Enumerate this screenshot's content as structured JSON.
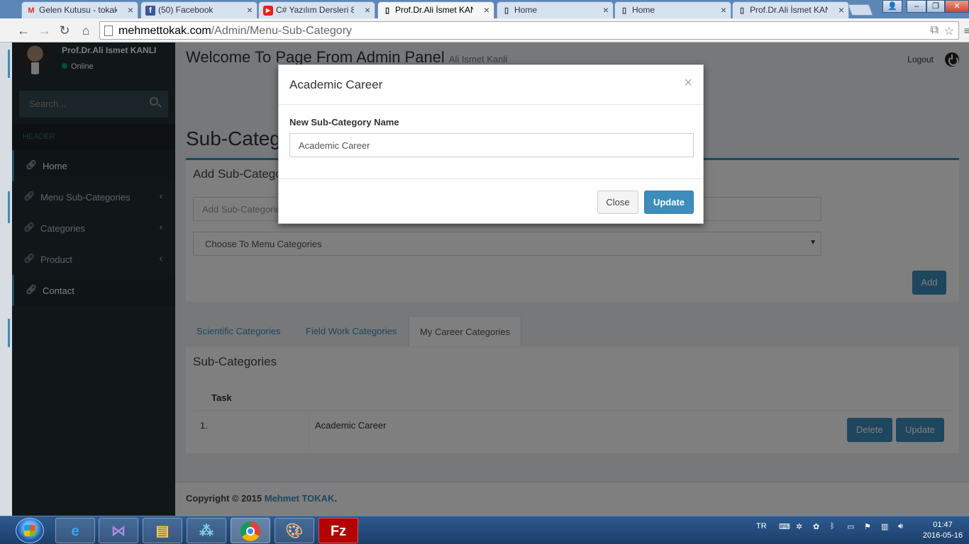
{
  "browser": {
    "tabs": [
      {
        "icon": "gmail-icon",
        "title": "Gelen Kutusu - tokak",
        "color": "#d93025"
      },
      {
        "icon": "facebook-icon",
        "title": "(50) Facebook",
        "color": "#3b5998"
      },
      {
        "icon": "youtube-icon",
        "title": "C# Yazılım Dersleri 8",
        "color": "#e62117"
      },
      {
        "icon": "page-icon",
        "title": "Prof.Dr.Ali İsmet KAN",
        "color": "#555555"
      },
      {
        "icon": "page-icon",
        "title": "Home",
        "color": "#555555"
      },
      {
        "icon": "page-icon",
        "title": "Home",
        "color": "#555555"
      },
      {
        "icon": "page-icon",
        "title": "Prof.Dr.Ali İsmet KAN",
        "color": "#555555"
      }
    ],
    "active_tab_index": 3,
    "url_domain": "mehmettokak.com",
    "url_path": "/Admin/Menu-Sub-Category"
  },
  "sidebar": {
    "user_name": "Prof.Dr.Ali Ismet KANLI",
    "user_status": "Online",
    "search_placeholder": "Search...",
    "header_label": "HEADER",
    "items": [
      {
        "label": "Home",
        "active": true,
        "has_chevron": false
      },
      {
        "label": "Menu Sub-Categories",
        "active": false,
        "has_chevron": true
      },
      {
        "label": "Categories",
        "active": false,
        "has_chevron": true
      },
      {
        "label": "Product",
        "active": false,
        "has_chevron": true
      },
      {
        "label": "Contact",
        "active": false,
        "has_chevron": false
      }
    ]
  },
  "header": {
    "welcome": "Welcome To Page From Admin Panel",
    "welcome_sub": "Ali Ismet Kanli",
    "logout": "Logout"
  },
  "main": {
    "section_title": "Sub-Categories",
    "add_box": {
      "title": "Add Sub-Categories",
      "input_placeholder": "Add Sub-Categories",
      "select_value": "Choose To Menu Categories",
      "add_button": "Add"
    },
    "tabs": [
      {
        "label": "Scientific Categories",
        "active": false
      },
      {
        "label": "Field Work Categories",
        "active": false
      },
      {
        "label": "My Career Categories",
        "active": true
      }
    ],
    "list_box": {
      "title": "Sub-Categories",
      "column_header": "Task",
      "rows": [
        {
          "num": "1.",
          "name": "Academic Career",
          "delete_label": "Delete",
          "update_label": "Update"
        }
      ]
    }
  },
  "footer": {
    "copyright": "Copyright © 2015",
    "author": "Mehmet TOKAK",
    "suffix": "."
  },
  "modal": {
    "title": "Academic Career",
    "close_x": "×",
    "field_label": "New Sub-Category Name",
    "field_value": "Academic Career",
    "close_button": "Close",
    "update_button": "Update"
  },
  "taskbar": {
    "language": "TR",
    "time": "01:47",
    "date": "2016-05-16"
  },
  "colors": {
    "accent": "#3c8dbc",
    "sidebar_bg": "#222d32",
    "online": "#00a65a"
  }
}
